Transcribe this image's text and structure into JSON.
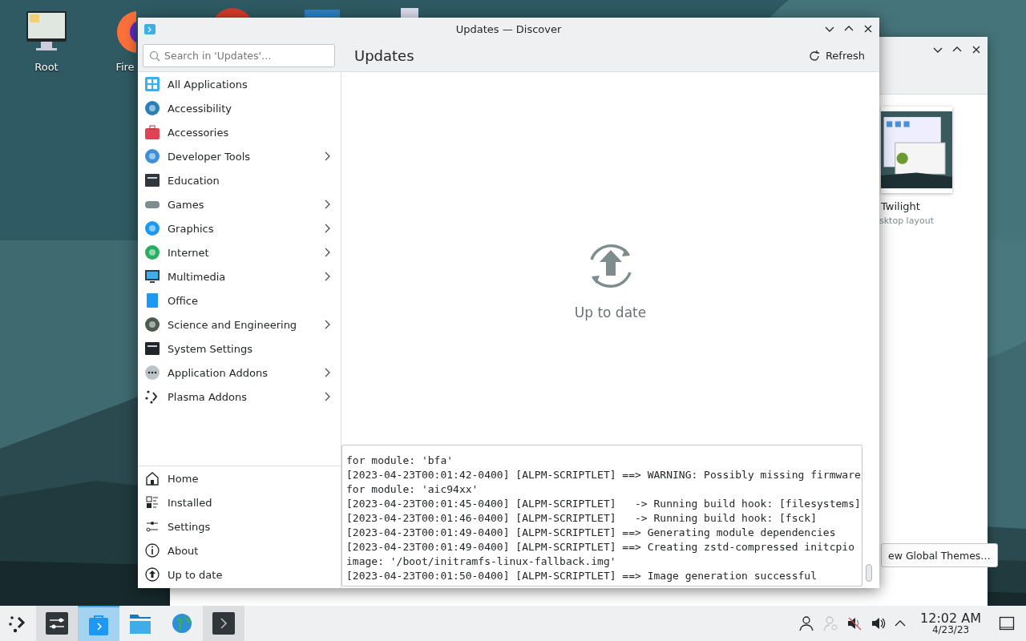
{
  "desktop": {
    "icons": [
      {
        "label": "Root",
        "kind": "monitor"
      },
      {
        "label": "Fire",
        "kind": "firefox"
      }
    ]
  },
  "background_window": {
    "item_title": "Twilight",
    "item_subtitle": "sktop layout",
    "button": "ew Global Themes…"
  },
  "window": {
    "title": "Updates — Discover",
    "search": {
      "placeholder": "Search in 'Updates'…"
    },
    "page_title": "Updates",
    "refresh": "Refresh",
    "categories": [
      {
        "label": "All Applications",
        "expandable": false
      },
      {
        "label": "Accessibility",
        "expandable": false
      },
      {
        "label": "Accessories",
        "expandable": false
      },
      {
        "label": "Developer Tools",
        "expandable": true
      },
      {
        "label": "Education",
        "expandable": false
      },
      {
        "label": "Games",
        "expandable": true
      },
      {
        "label": "Graphics",
        "expandable": true
      },
      {
        "label": "Internet",
        "expandable": true
      },
      {
        "label": "Multimedia",
        "expandable": true
      },
      {
        "label": "Office",
        "expandable": false
      },
      {
        "label": "Science and Engineering",
        "expandable": true
      },
      {
        "label": "System Settings",
        "expandable": false
      },
      {
        "label": "Application Addons",
        "expandable": true
      },
      {
        "label": "Plasma Addons",
        "expandable": true
      }
    ],
    "navigation": [
      {
        "label": "Home"
      },
      {
        "label": "Installed"
      },
      {
        "label": "Settings"
      },
      {
        "label": "About"
      },
      {
        "label": "Up to date"
      }
    ],
    "status": "Up to date",
    "log_lines": [
      "for module: 'bfa'",
      "[2023-04-23T00:01:42-0400] [ALPM-SCRIPTLET] ==> WARNING: Possibly missing firmware",
      "for module: 'aic94xx'",
      "[2023-04-23T00:01:45-0400] [ALPM-SCRIPTLET]   -> Running build hook: [filesystems]",
      "[2023-04-23T00:01:46-0400] [ALPM-SCRIPTLET]   -> Running build hook: [fsck]",
      "[2023-04-23T00:01:49-0400] [ALPM-SCRIPTLET] ==> Generating module dependencies",
      "[2023-04-23T00:01:49-0400] [ALPM-SCRIPTLET] ==> Creating zstd-compressed initcpio",
      "image: '/boot/initramfs-linux-fallback.img'",
      "[2023-04-23T00:01:50-0400] [ALPM-SCRIPTLET] ==> Image generation successful"
    ]
  },
  "taskbar": {
    "tasks": [
      {
        "kind": "settings",
        "selected": false
      },
      {
        "kind": "discover",
        "selected": true
      },
      {
        "kind": "files",
        "selected": false
      },
      {
        "kind": "browser",
        "selected": false
      },
      {
        "kind": "terminal",
        "selected": false
      }
    ],
    "time": "12:02 AM",
    "date": "4/23/23"
  }
}
